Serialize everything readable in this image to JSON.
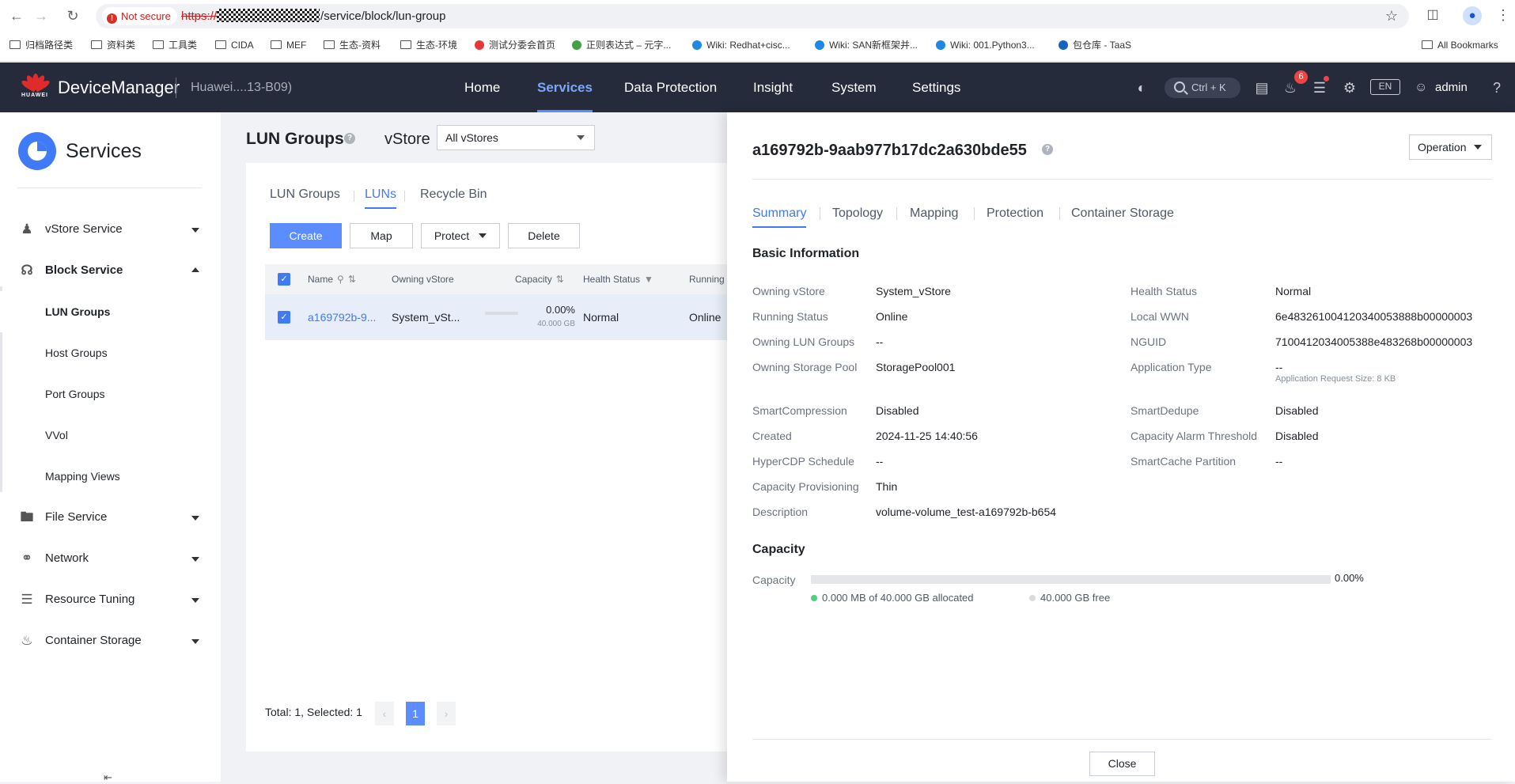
{
  "browser": {
    "security": "Not secure",
    "url_scheme": "https://",
    "url_path": "/service/block/lun-group",
    "bookmarks": [
      "归档路径类",
      "资料类",
      "工具类",
      "CIDA",
      "MEF",
      "生态-资料",
      "生态-环境",
      "测试分委会首页",
      "正则表达式 – 元字...",
      "Wiki: Redhat+cisc...",
      "Wiki: SAN新框架并...",
      "Wiki: 001.Python3...",
      "包仓库 - TaaS"
    ],
    "all_bookmarks": "All Bookmarks"
  },
  "header": {
    "logo_text": "HUAWEI",
    "app_name": "DeviceManager",
    "device": "Huawei....13-B09)",
    "nav": [
      "Home",
      "Services",
      "Data Protection",
      "Insight",
      "System",
      "Settings"
    ],
    "active_nav": "Services",
    "search_hint": "Ctrl + K",
    "notifications": "6",
    "lang": "EN",
    "user": "admin"
  },
  "sidebar": {
    "title": "Services",
    "groups": [
      {
        "label": "vStore Service",
        "icon": "users-icon"
      },
      {
        "label": "Block Service",
        "icon": "database-icon"
      },
      {
        "label": "File Service",
        "icon": "folder-icon"
      },
      {
        "label": "Network",
        "icon": "planet-icon"
      },
      {
        "label": "Resource Tuning",
        "icon": "layers-icon"
      },
      {
        "label": "Container Storage",
        "icon": "container-icon"
      }
    ],
    "block_items": [
      "LUN Groups",
      "Host Groups",
      "Port Groups",
      "VVol",
      "Mapping Views"
    ],
    "active_item": "LUN Groups"
  },
  "main": {
    "title": "LUN Groups",
    "vstore_label": "vStore",
    "vstore_value": "All vStores",
    "tabs": [
      "LUN Groups",
      "LUNs",
      "Recycle Bin"
    ],
    "active_tab": "LUNs",
    "buttons": {
      "create": "Create",
      "map": "Map",
      "protect": "Protect",
      "delete": "Delete"
    },
    "columns": [
      "Name",
      "Owning vStore",
      "Capacity",
      "Health Status",
      "Running"
    ],
    "row": {
      "name": "a169792b-9...",
      "vstore": "System_vSt...",
      "capacity_pct": "0.00%",
      "capacity_total": "40.000 GB",
      "health": "Normal",
      "running": "Online"
    },
    "pager": {
      "summary": "Total: 1, Selected: 1",
      "page": "1"
    }
  },
  "drawer": {
    "lun_name": "a169792b-9aab977b17dc2a630bde55",
    "operation": "Operation",
    "tabs": [
      "Summary",
      "Topology",
      "Mapping",
      "Protection",
      "Container Storage"
    ],
    "active_tab": "Summary",
    "basic_title": "Basic Information",
    "left_fields": [
      {
        "label": "Owning vStore",
        "value": "System_vStore"
      },
      {
        "label": "Running Status",
        "value": "Online"
      },
      {
        "label": "Owning LUN Groups",
        "value": "--"
      },
      {
        "label": "Owning Storage Pool",
        "value": "StoragePool001"
      },
      {
        "label": "SmartCompression",
        "value": "Disabled"
      },
      {
        "label": "Created",
        "value": "2024-11-25 14:40:56"
      },
      {
        "label": "HyperCDP Schedule",
        "value": "--"
      },
      {
        "label": "Capacity Provisioning",
        "value": "Thin"
      },
      {
        "label": "Description",
        "value": "volume-volume_test-a169792b-b654"
      }
    ],
    "right_fields": [
      {
        "label": "Health Status",
        "value": "Normal"
      },
      {
        "label": "Local WWN",
        "value": "6e48326100412034005388 8b00000003"
      },
      {
        "label": "NGUID",
        "value": "7100412034005388e483268b00000003"
      },
      {
        "label": "Application Type",
        "value": "--"
      },
      {
        "label": "SmartDedupe",
        "value": "Disabled"
      },
      {
        "label": "Capacity Alarm Threshold",
        "value": "Disabled"
      },
      {
        "label": "SmartCache Partition",
        "value": "--"
      }
    ],
    "app_request_size": "Application Request Size: 8 KB",
    "capacity_title": "Capacity",
    "capacity_label": "Capacity",
    "capacity_pct": "0.00%",
    "capacity_fraction": 0.0,
    "allocated": "0.000 MB of 40.000 GB allocated",
    "free": "40.000 GB free",
    "close": "Close"
  },
  "colors": {
    "accent": "#3f7bf6",
    "header_bg": "#252b3a",
    "allocated_dot": "#4cd07d",
    "free_dot": "#d8dbe0"
  }
}
